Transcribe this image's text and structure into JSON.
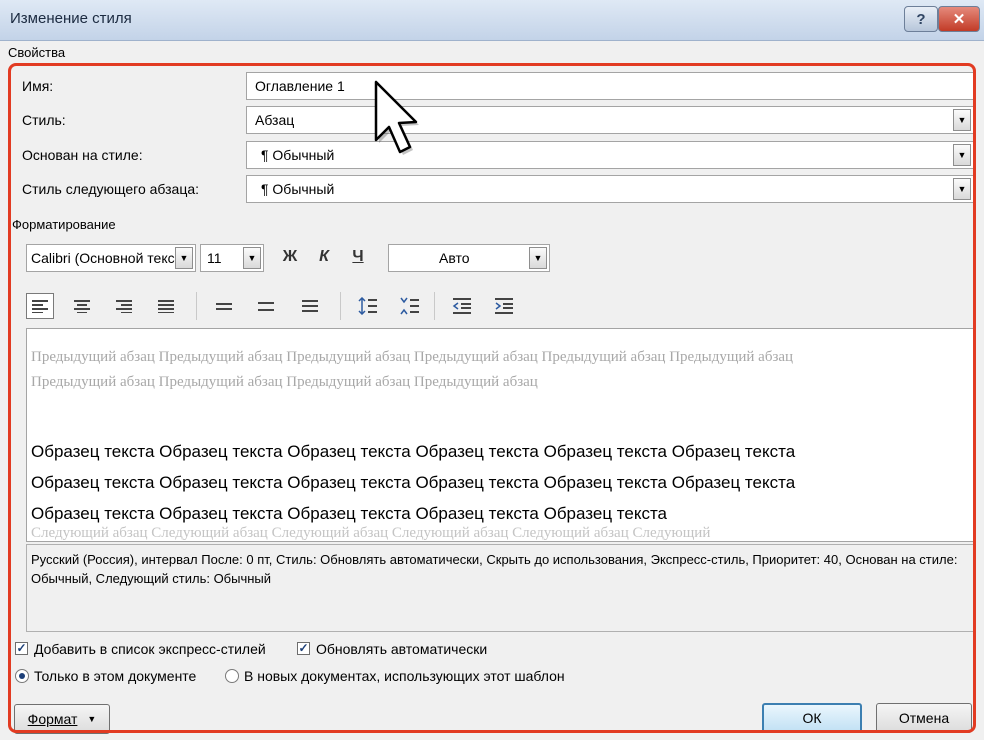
{
  "window": {
    "title": "Изменение стиля"
  },
  "properties": {
    "section_label": "Свойства",
    "name": {
      "label": "Имя:",
      "value": "Оглавление 1"
    },
    "style_type": {
      "label": "Стиль:",
      "value": "Абзац"
    },
    "based_on": {
      "label": "Основан на стиле:",
      "value": "¶ Обычный"
    },
    "next_style": {
      "label": "Стиль следующего абзаца:",
      "value": "¶ Обычный"
    }
  },
  "formatting": {
    "section_label": "Форматирование",
    "font": "Calibri (Основной текс",
    "size": "11",
    "bold": "Ж",
    "italic": "К",
    "underline": "Ч",
    "color": "Авто"
  },
  "preview": {
    "previous_text": "Предыдущий абзац Предыдущий абзац Предыдущий абзац Предыдущий абзац Предыдущий абзац Предыдущий абзац Предыдущий абзац Предыдущий абзац Предыдущий абзац Предыдущий абзац",
    "sample_lines": [
      "Образец текста Образец текста Образец текста Образец текста Образец текста Образец текста",
      "Образец текста Образец текста Образец текста Образец текста Образец текста Образец текста",
      "Образец текста Образец текста Образец текста Образец текста Образец текста"
    ],
    "next_text": "Следующий абзац Следующий абзац Следующий абзац Следующий абзац Следующий абзац Следующий"
  },
  "description": "Русский (Россия), интервал После:  0 пт, Стиль: Обновлять автоматически, Скрыть до использования, Экспресс-стиль, Приоритет: 40, Основан на стиле: Обычный, Следующий стиль: Обычный",
  "options": {
    "add_to_quick": {
      "label": "Добавить в список экспресс-стилей",
      "checked": true
    },
    "auto_update": {
      "label": "Обновлять автоматически",
      "checked": true
    },
    "only_this_doc": {
      "label": "Только в этом документе",
      "selected": true
    },
    "new_docs": {
      "label": "В новых документах, использующих этот шаблон",
      "selected": false
    }
  },
  "buttons": {
    "format": "Формат",
    "ok": "ОК",
    "cancel": "Отмена"
  },
  "icons": {
    "titlebar": [
      "help-icon",
      "close-icon"
    ],
    "align": [
      "align-left-icon",
      "align-center-icon",
      "align-right-icon",
      "align-justify-icon"
    ],
    "spacing": [
      "single-spacing-icon",
      "one-half-spacing-icon",
      "double-spacing-icon"
    ],
    "paragraph": [
      "increase-paragraph-spacing-icon",
      "decrease-paragraph-spacing-icon"
    ],
    "indent": [
      "decrease-indent-icon",
      "increase-indent-icon"
    ]
  },
  "colors": {
    "highlight_frame": "#e23b22",
    "default_button_border": "#3c7fb1",
    "close_button": "#c23b27"
  }
}
